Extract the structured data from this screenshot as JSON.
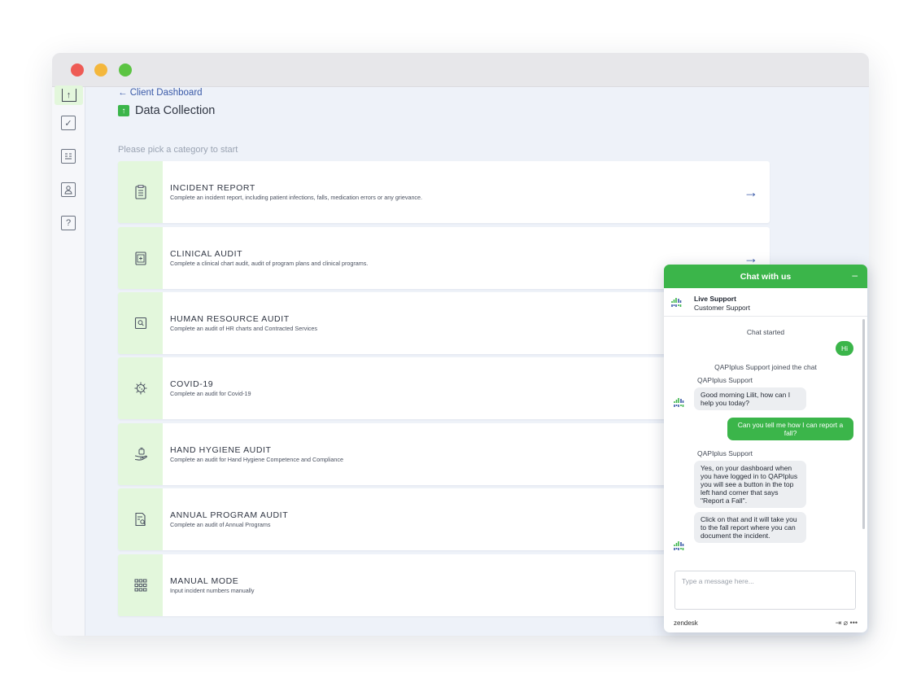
{
  "back_link": "← Client Dashboard",
  "page_title": "Data Collection",
  "subtitle": "Please pick a category to start",
  "cards": [
    {
      "title": "INCIDENT REPORT",
      "desc": "Complete an incident report, including patient infections, falls, medication errors or any grievance.",
      "icon": "clipboard-icon",
      "arrow": "→"
    },
    {
      "title": "CLINICAL AUDIT",
      "desc": "Complete a clinical chart audit, audit of program plans and clinical programs.",
      "icon": "medical-chart-icon",
      "arrow": "→"
    },
    {
      "title": "HUMAN RESOURCE AUDIT",
      "desc": "Complete an audit of HR charts and Contracted Services",
      "icon": "search-document-icon",
      "arrow": ""
    },
    {
      "title": "COVID-19",
      "desc": "Complete an audit for Covid-19",
      "icon": "virus-icon",
      "arrow": ""
    },
    {
      "title": "HAND HYGIENE AUDIT",
      "desc": "Complete an audit for Hand Hygiene Competence and Compliance",
      "icon": "hand-wash-icon",
      "arrow": ""
    },
    {
      "title": "ANNUAL PROGRAM AUDIT",
      "desc": "Complete an audit of Annual Programs",
      "icon": "document-search-icon",
      "arrow": ""
    },
    {
      "title": "MANUAL MODE",
      "desc": "Input incident numbers manually",
      "icon": "grid-icon",
      "arrow": ""
    }
  ],
  "chat": {
    "header": "Chat with us",
    "minimize": "–",
    "agent_name": "Live Support",
    "agent_role": "Customer Support",
    "chat_started": "Chat started",
    "msg_hi": "Hi",
    "joined": "QAPIplus Support joined the chat",
    "sender": "QAPIplus Support",
    "msg_greeting": "Good morning Lilit, how can I help you today?",
    "msg_question": "Can you tell me how I can report a fall?",
    "msg_answer1": "Yes, on your dashboard when you have logged in to QAPIplus you will see a button in the top left hand corner that says \"Report a Fall\".",
    "msg_answer2": "Click on that and it will take you to the fall report where you can document the incident.",
    "input_placeholder": "Type a message here...",
    "footer_brand": "zendesk",
    "footer_icons": "⇥  ⌀  •••"
  },
  "colors": {
    "accent_green": "#3bb54a",
    "card_icon_bg": "#e3f7dc",
    "link_blue": "#3a5aa8"
  }
}
